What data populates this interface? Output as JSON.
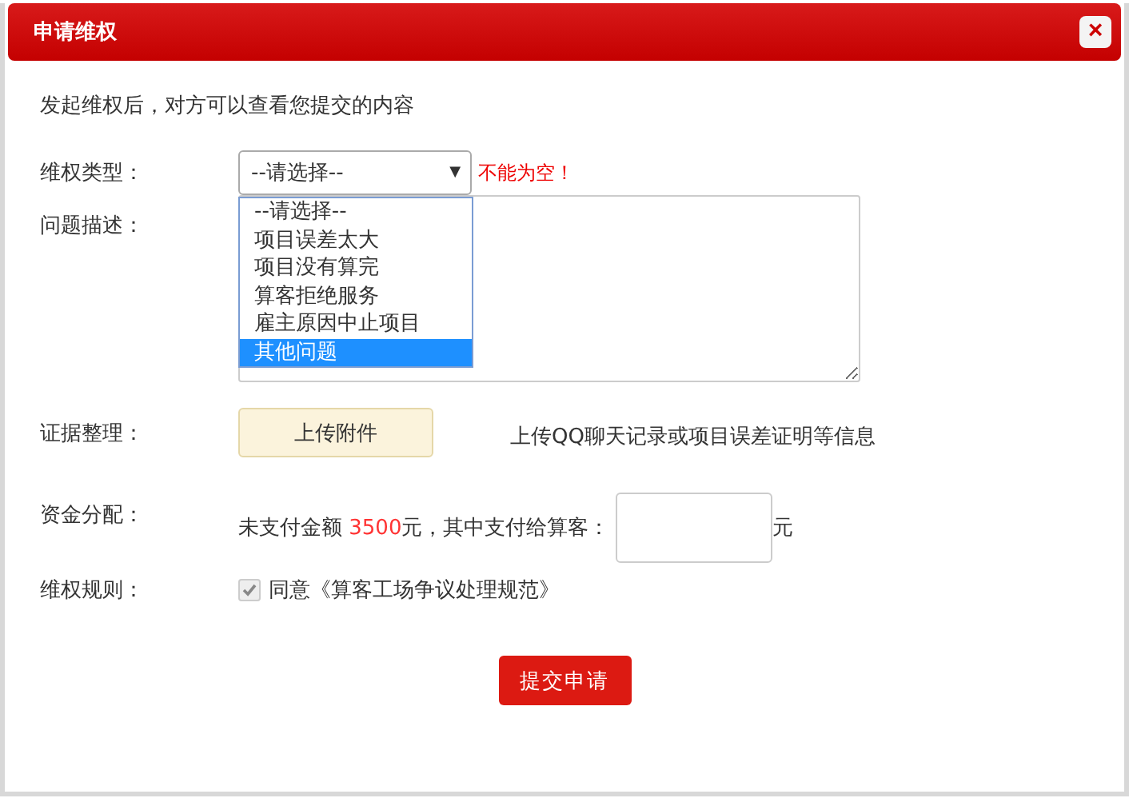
{
  "dialog": {
    "title": "申请维权",
    "close": "×"
  },
  "intro": "发起维权后，对方可以查看您提交的内容",
  "type_row": {
    "label": "维权类型：",
    "value": "--请选择--",
    "arrow": "▼",
    "error": "不能为空！",
    "options": [
      {
        "label": "--请选择--",
        "highlighted": false
      },
      {
        "label": "项目误差太大",
        "highlighted": false
      },
      {
        "label": "项目没有算完",
        "highlighted": false
      },
      {
        "label": "算客拒绝服务",
        "highlighted": false
      },
      {
        "label": "雇主原因中止项目",
        "highlighted": false
      },
      {
        "label": "其他问题",
        "highlighted": true
      }
    ]
  },
  "description_row": {
    "label": "问题描述："
  },
  "evidence_row": {
    "label": "证据整理：",
    "button": "上传附件",
    "hint": "上传QQ聊天记录或项目误差证明等信息"
  },
  "funds_row": {
    "label": "资金分配：",
    "prefix": "未支付金额 ",
    "amount": "3500",
    "suffix": "元，其中支付给算客：",
    "unit": "元"
  },
  "rules_row": {
    "label": "维权规则：",
    "checked": true,
    "agreement": "同意《算客工场争议处理规范》"
  },
  "submit": "提交申请"
}
